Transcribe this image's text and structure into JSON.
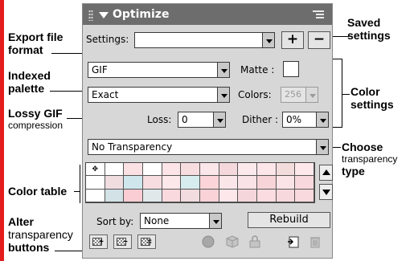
{
  "panel": {
    "title": "Optimize",
    "settings_label": "Settings:",
    "settings_value": "",
    "add_button": "+",
    "remove_button": "−",
    "format_value": "GIF",
    "matte_label": "Matte :",
    "palette_value": "Exact",
    "colors_label": "Colors:",
    "colors_value": "256",
    "loss_label": "Loss:",
    "loss_value": "0",
    "dither_label": "Dither :",
    "dither_value": "0%",
    "transparency_value": "No Transparency",
    "sortby_label": "Sort by:",
    "sortby_value": "None",
    "rebuild_button": "Rebuild",
    "first_cell_mark": "✥"
  },
  "color_table": [
    [
      "#ffffff",
      "#ffffff",
      "#fbe0e4",
      "#ffffff",
      "#fce4e8",
      "#f7dce0",
      "#fbe6ea",
      "#f4d8dc",
      "#fbe9ec",
      "#fde6ea",
      "#f3dcdc",
      "#ffe8ec"
    ],
    [
      "#ffffff",
      "#f0dde0",
      "#cfe7ec",
      "#f7dde0",
      "#fce8ea",
      "#d7ecef",
      "#fad4d8",
      "#fae6e9",
      "#f9e3e6",
      "#f7d4d8",
      "#fbe4e7",
      "#f8d8dd"
    ],
    [
      "#ffffff",
      "#d2e2e6",
      "#f9cdd3",
      "#e0e8ea",
      "#fad9de",
      "#f2dcdf",
      "#f9d2d8",
      "#fde7ea",
      "#f5d6da",
      "#fbdde1",
      "#f7d8dc",
      "#f9d9dd"
    ]
  ],
  "annotations": {
    "export_format_1": "Export file",
    "export_format_2": "format",
    "indexed_1": "Indexed",
    "indexed_2": "palette",
    "lossy_1": "Lossy GIF",
    "lossy_2": "compression",
    "color_table": "Color table",
    "alter_1": "Alter",
    "alter_2": "transparency",
    "alter_3": "buttons",
    "saved_1": "Saved",
    "saved_2": "settings",
    "color_1": "Color",
    "color_2": "settings",
    "choose_1": "Choose",
    "choose_2": "transparency",
    "choose_3": "type"
  },
  "icons": [
    "grip-icon",
    "collapse-triangle-icon",
    "panel-menu-icon",
    "add-transparency-icon",
    "remove-transparency-icon",
    "select-transparency-icon",
    "web-snap-icon",
    "lock-color-icon",
    "lock-icon",
    "new-color-icon",
    "trash-icon"
  ],
  "colors": {
    "title_bar": "#6d6d6d",
    "panel_bg": "#d7d7d7",
    "accent_bar": "#e31c1c"
  }
}
